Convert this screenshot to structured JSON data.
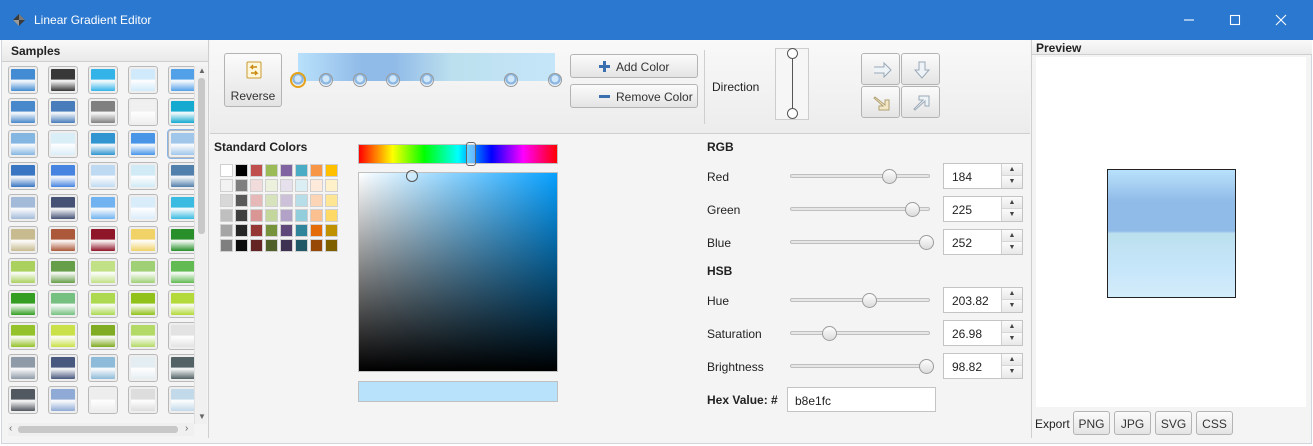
{
  "window": {
    "title": "Linear Gradient Editor",
    "icon": "app-diamond-icon",
    "controls": [
      "minimize-icon",
      "maximize-icon",
      "close-icon"
    ]
  },
  "samples": {
    "title": "Samples",
    "swatch_gradients": [
      [
        "#3a86d0",
        "#2e2e2e",
        "#2ab0e8",
        "#cfeafc",
        "#4a9de8"
      ],
      [
        "#3f82c9",
        "#3f76b8",
        "#7a7a7a",
        "#f0f0f0",
        "#0aa6cf"
      ],
      [
        "#7fb3e2",
        "#d9eef9",
        "#2690cf",
        "#3f90e8",
        "#9cc4ea"
      ],
      [
        "#2f6fc0",
        "#3e7fe0",
        "#bcd9f2",
        "#cfeaf6",
        "#4a7aa8"
      ],
      [
        "#9fb8d8",
        "#3c4a70",
        "#6ab0f0",
        "#d8ecfb",
        "#30b8e0"
      ],
      [
        "#c5b88a",
        "#a85030",
        "#8a0a1e",
        "#f0d060",
        "#1e8a20"
      ],
      [
        "#a7cf56",
        "#5f9a40",
        "#bfe080",
        "#9ccf70",
        "#5ab84a"
      ],
      [
        "#2a9a18",
        "#6fbe7a",
        "#a8d848",
        "#8cc010",
        "#b0d830"
      ],
      [
        "#8fc020",
        "#c8e040",
        "#7aa818",
        "#b0d860",
        "#e2e2e2"
      ],
      [
        "#8a96a4",
        "#405078",
        "#88b8d8",
        "#e4eef2",
        "#4a5a5e"
      ],
      [
        "#4a5058",
        "#8aa6d4",
        "#ededed",
        "#dcdcdc",
        "#c0d8ea"
      ]
    ]
  },
  "toolbar": {
    "reverse_label": "Reverse",
    "add_color_label": "Add Color",
    "remove_color_label": "Remove Color",
    "direction_label": "Direction",
    "gradient_stops": [
      0.0,
      0.11,
      0.24,
      0.37,
      0.5,
      0.83,
      1.0
    ],
    "active_stop_index": 0,
    "direction_buttons": [
      "arrow-right-icon",
      "arrow-down-icon",
      "arrow-diagonal-down-icon",
      "arrow-diagonal-up-icon"
    ]
  },
  "picker": {
    "standard_colors_title": "Standard Colors",
    "standard_colors": [
      [
        "#ffffff",
        "#000000",
        "#c0504d",
        "#9bbb59",
        "#8064a2",
        "#4bacc6",
        "#f79646",
        "#ffc000"
      ],
      [
        "#f2f2f2",
        "#7f7f7f",
        "#f2dcdb",
        "#ebf1dd",
        "#e5e0ec",
        "#dbeef3",
        "#fdeada",
        "#fff2ca"
      ],
      [
        "#d8d8d8",
        "#595959",
        "#e6b9b8",
        "#d7e3bc",
        "#ccc1d9",
        "#b7dde8",
        "#fbd5b5",
        "#ffe694"
      ],
      [
        "#bfbfbf",
        "#3f3f3f",
        "#d99694",
        "#c3d69b",
        "#b2a2c7",
        "#92cddc",
        "#fac08f",
        "#ffd965"
      ],
      [
        "#a5a5a5",
        "#262626",
        "#953734",
        "#76923c",
        "#5f497a",
        "#31859b",
        "#e36c09",
        "#bf9000"
      ],
      [
        "#7f7f7f",
        "#0c0c0c",
        "#632423",
        "#4f6128",
        "#3f3151",
        "#205867",
        "#974806",
        "#7f6000"
      ]
    ],
    "current_color": "#b8e1fc",
    "hue_position": 0.5662,
    "saturation": 0.2698,
    "brightness": 0.9882
  },
  "rgb": {
    "title": "RGB",
    "red_label": "Red",
    "red_value": "184",
    "green_label": "Green",
    "green_value": "225",
    "blue_label": "Blue",
    "blue_value": "252"
  },
  "hsb": {
    "title": "HSB",
    "hue_label": "Hue",
    "hue_value": "203.82",
    "saturation_label": "Saturation",
    "saturation_value": "26.98",
    "brightness_label": "Brightness",
    "brightness_value": "98.82"
  },
  "hex": {
    "label": "Hex Value: #",
    "value": "b8e1fc"
  },
  "preview": {
    "title": "Preview",
    "export_label": "Export",
    "export_buttons": [
      "PNG",
      "JPG",
      "SVG",
      "CSS"
    ]
  }
}
